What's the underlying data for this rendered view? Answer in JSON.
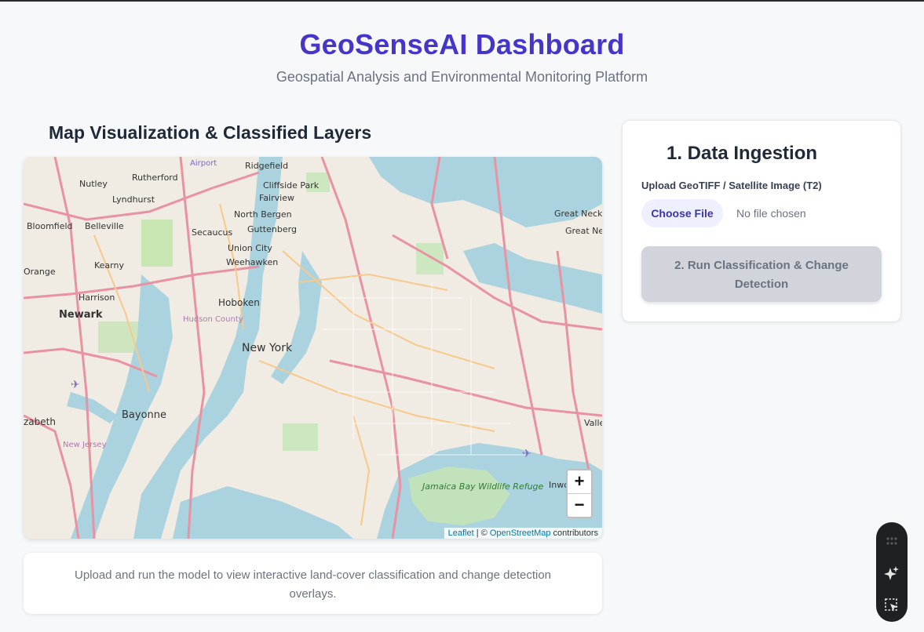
{
  "header": {
    "title": "GeoSenseAI Dashboard",
    "subtitle": "Geospatial Analysis and Environmental Monitoring Platform"
  },
  "map_section": {
    "heading": "Map Visualization & Classified Layers",
    "zoom_in_label": "+",
    "zoom_out_label": "−",
    "attribution": {
      "leaflet": "Leaflet",
      "separator": " | © ",
      "osm": "OpenStreetMap",
      "contributors": " contributors"
    },
    "map_labels": {
      "newark": "Newark",
      "hoboken": "Hoboken",
      "new_york": "New York",
      "bayonne": "Bayonne",
      "harrison": "Harrison",
      "kearny": "Kearny",
      "belleville": "Belleville",
      "bloomfield": "Bloomfield",
      "nutley": "Nutley",
      "rutherford": "Rutherford",
      "lyndhurst": "Lyndhurst",
      "ridgefield": "Ridgefield",
      "cliffside_park": "Cliffside Park",
      "fairview": "Fairview",
      "north_bergen": "North Bergen",
      "secaucus": "Secaucus",
      "guttenberg": "Guttenberg",
      "union_city": "Union City",
      "weehawken": "Weehawken",
      "great_neck": "Great Neck",
      "great_neck_plaza": "Great Neck Plaza",
      "jamaica_bay": "Jamaica Bay Wildlife Refuge",
      "hudson_county": "Hudson County",
      "new_jersey": "New Jersey",
      "airport": "Airport",
      "elizabeth": "zabeth",
      "orange": "Orange",
      "valle": "Valle",
      "inwo": "Inwo"
    },
    "placeholder_note": "Upload and run the model to view interactive land-cover classification and change detection overlays."
  },
  "ingestion_panel": {
    "title": "1. Data Ingestion",
    "upload_label": "Upload GeoTIFF / Satellite Image (T2)",
    "choose_file_label": "Choose File",
    "file_status": "No file chosen",
    "run_button_label": "2. Run Classification & Change Detection"
  },
  "floating_toolbar": {
    "icons": [
      "grip-icon",
      "sparkle-icon",
      "select-cursor-icon"
    ]
  },
  "colors": {
    "brand": "#4535c9",
    "water": "#aad3df",
    "land": "#eee7dc",
    "highway": "#e892a2"
  }
}
